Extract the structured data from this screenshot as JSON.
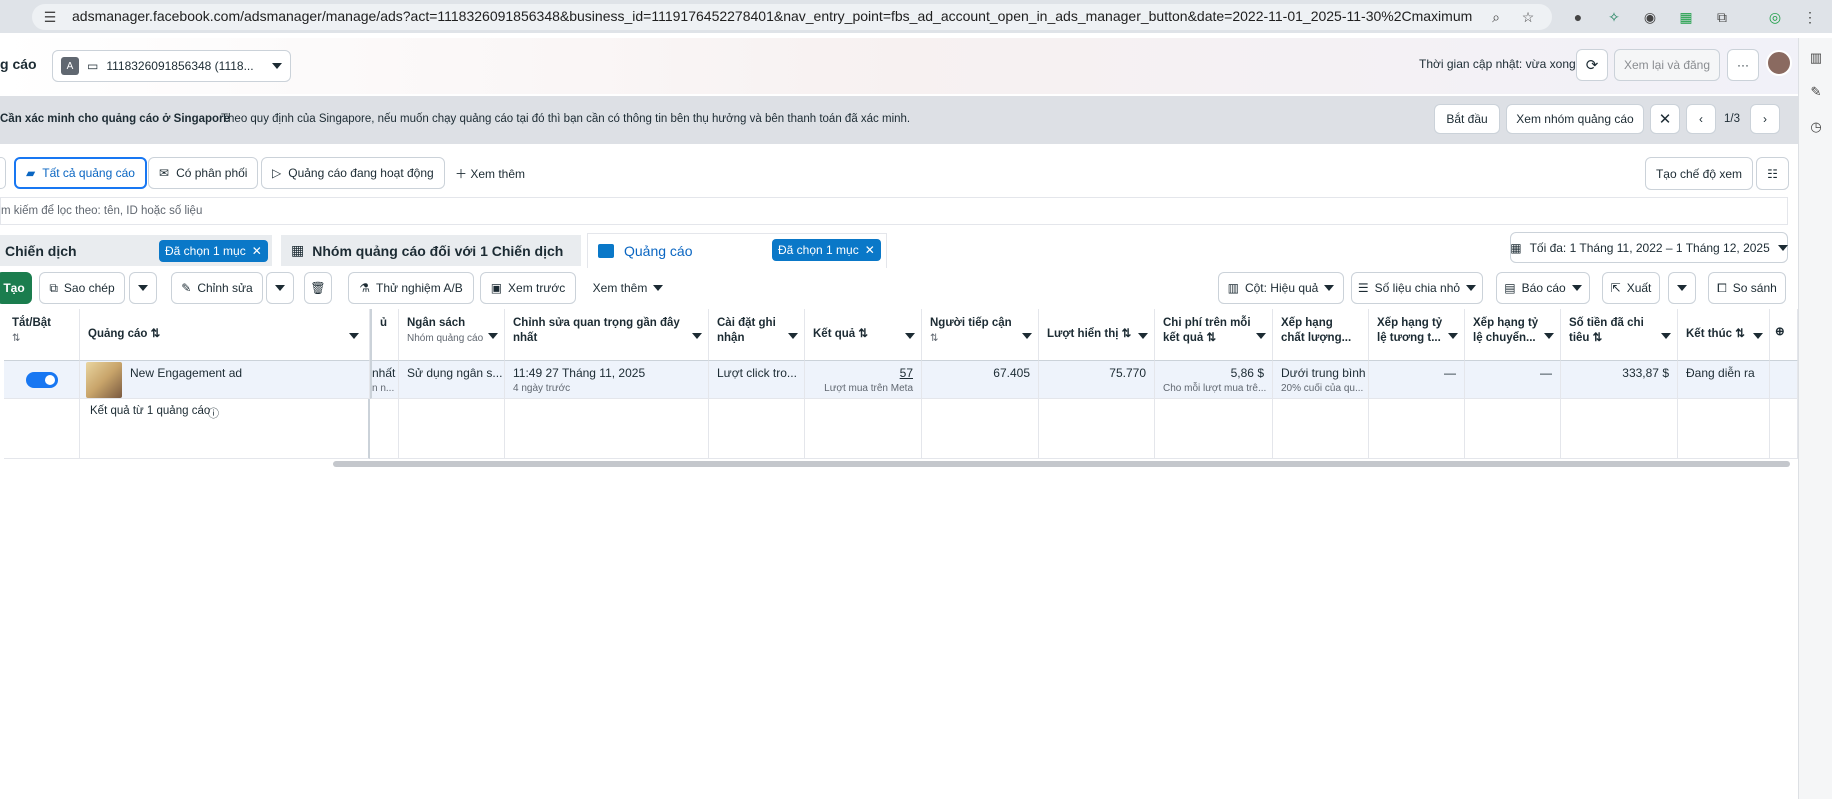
{
  "browser": {
    "url": "adsmanager.facebook.com/adsmanager/manage/ads?act=1118326091856348&business_id=1119176452278401&nav_entry_point=fbs_ad_account_open_in_ads_manager_button&date=2022-11-01_2025-11-30%2Cmaximum..."
  },
  "header": {
    "title_partial": "g cáo",
    "account_badge": "A",
    "account_id": "1118326091856348 (1118...",
    "update_status": "Thời gian cập nhật: vừa xong",
    "review_publish": "Xem lại và đăng",
    "more": "···"
  },
  "banner": {
    "title": "Cần xác minh cho quảng cáo ở Singapore",
    "text": "Theo quy định của Singapore, nếu muốn chạy quảng cáo tại đó thì bạn cần có thông tin bên thụ hưởng và bên thanh toán đã xác minh.",
    "start": "Bắt đầu",
    "view_adset": "Xem nhóm quảng cáo",
    "pager": "1/3"
  },
  "filters": {
    "all_ads": "Tất cả quảng cáo",
    "delivery": "Có phân phối",
    "active_ads": "Quảng cáo đang hoạt động",
    "more": "Xem thêm",
    "create_view": "Tạo chế độ xem"
  },
  "search": {
    "placeholder": "m kiếm để lọc theo: tên, ID hoặc số liệu"
  },
  "tabs": {
    "campaign": "Chiến dịch",
    "campaign_tag": "Đã chọn 1 mục",
    "adset": "Nhóm quảng cáo đối với 1 Chiến dịch",
    "ads": "Quảng cáo",
    "ads_tag": "Đã chọn 1 mục",
    "date_range": "Tối đa: 1 Tháng 11, 2022 – 1 Tháng 12, 2025"
  },
  "toolbar": {
    "create": "Tạo",
    "duplicate": "Sao chép",
    "edit": "Chỉnh sửa",
    "ab_test": "Thử nghiệm A/B",
    "preview": "Xem trước",
    "more": "Xem thêm",
    "columns": "Cột: Hiệu quả",
    "breakdown": "Số liệu chia nhỏ",
    "reports": "Báo cáo",
    "export": "Xuất",
    "compare": "So sánh"
  },
  "columns": {
    "toggle": "Tắt/Bật",
    "ad": "Quảng cáo",
    "budget": "Ngân sách",
    "budget_sub": "Nhóm quảng cáo",
    "last_edit": "Chỉnh sửa quan trọng gần đây nhất",
    "attribution": "Cài đặt ghi nhận",
    "results": "Kết quả",
    "reach": "Người tiếp cận",
    "impressions": "Lượt hiển thị",
    "cost_per_result": "Chi phí trên mỗi kết quả",
    "quality_rank": "Xếp hạng chất lượng...",
    "engagement_rank": "Xếp hạng tỷ lệ tương t...",
    "conversion_rank": "Xếp hạng tỷ lệ chuyển...",
    "amount_spent": "Số tiền đã chi tiêu",
    "ends": "Kết thúc",
    "partial_col": "ủ"
  },
  "row": {
    "ad_name": "New Engagement ad",
    "partial_a": "nhất",
    "partial_b": "n n...",
    "budget": "Sử dụng ngân s...",
    "last_edit": "11:49 27 Tháng 11, 2025",
    "last_edit_sub": "4 ngày trước",
    "attribution": "Lượt click tro...",
    "results": "57",
    "results_sub": "Lượt mua trên Meta",
    "reach": "67.405",
    "impressions": "75.770",
    "cost_per_result": "5,86 $",
    "cost_sub": "Cho mỗi lượt mua trê...",
    "quality": "Dưới trung bình",
    "quality_sub": "20% cuối của qu...",
    "engagement": "—",
    "conversion": "—",
    "spent": "333,87 $",
    "ends": "Đang diễn ra"
  },
  "footer": {
    "results_from": "Kết quả từ 1 quảng cáo"
  },
  "colors": {
    "accent": "#1877f2",
    "create_green": "#1b7d4e",
    "tag_blue": "#0a78c8"
  }
}
